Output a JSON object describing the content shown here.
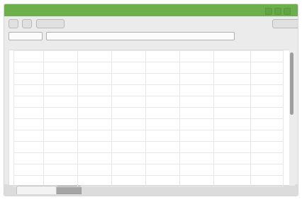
{
  "window": {
    "titlebar": {
      "title": "",
      "accent_color": "#6db04b"
    },
    "controls": [
      "minimize-icon",
      "maximize-icon",
      "close-icon"
    ]
  },
  "toolbar": {
    "buttons": [
      {
        "label": ""
      },
      {
        "label": ""
      },
      {
        "label": ""
      }
    ],
    "right_button": {
      "label": ""
    }
  },
  "formula_bar": {
    "name_box_value": "",
    "input_value": ""
  },
  "sheet": {
    "rows": 12,
    "columns": 8,
    "cells": []
  },
  "tabs": [
    {
      "label": "",
      "active": true
    },
    {
      "label": "",
      "active": false
    }
  ]
}
